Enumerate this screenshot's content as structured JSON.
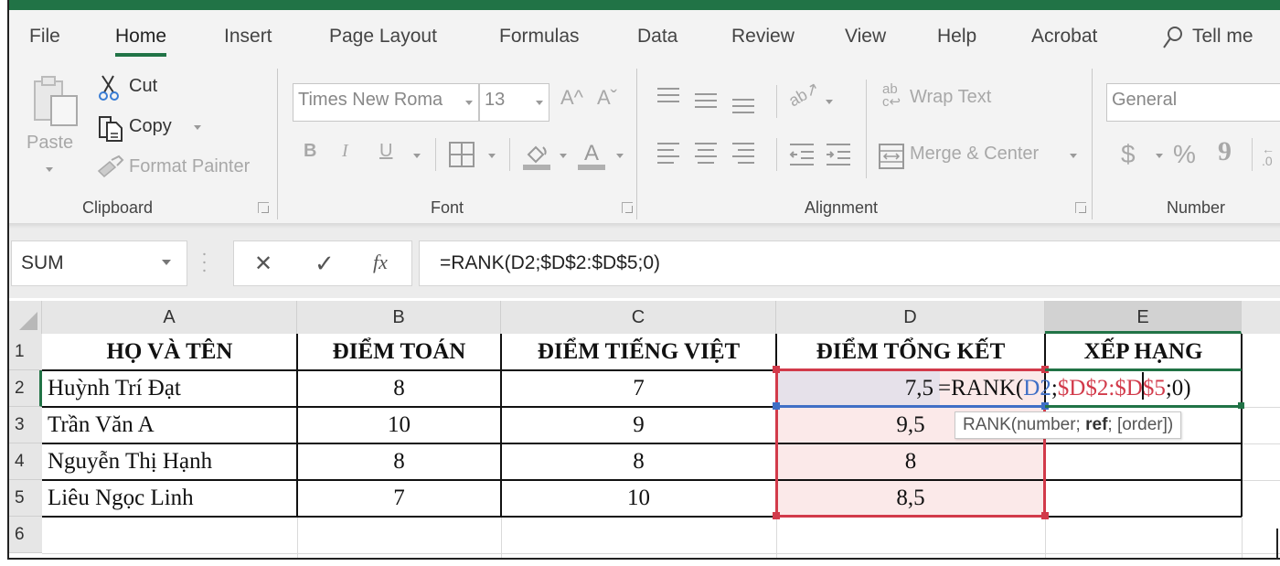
{
  "ribbon_tabs": [
    {
      "label": "File",
      "active": false
    },
    {
      "label": "Home",
      "active": true
    },
    {
      "label": "Insert",
      "active": false
    },
    {
      "label": "Page Layout",
      "active": false
    },
    {
      "label": "Formulas",
      "active": false
    },
    {
      "label": "Data",
      "active": false
    },
    {
      "label": "Review",
      "active": false
    },
    {
      "label": "View",
      "active": false
    },
    {
      "label": "Help",
      "active": false
    },
    {
      "label": "Acrobat",
      "active": false
    }
  ],
  "tell_me": {
    "label": "Tell me",
    "icon": "search-icon"
  },
  "clipboard": {
    "paste_label": "Paste",
    "cut_label": "Cut",
    "copy_label": "Copy",
    "format_painter_label": "Format Painter",
    "group_label": "Clipboard"
  },
  "font": {
    "font_name": "Times New Roma",
    "font_size": "13",
    "increase_size_icon": "A^",
    "decrease_size_icon": "Aˇ",
    "bold_label": "B",
    "italic_label": "I",
    "underline_label": "U",
    "group_label": "Font"
  },
  "alignment": {
    "wrap_text_label": "Wrap Text",
    "merge_center_label": "Merge & Center",
    "group_label": "Alignment"
  },
  "number": {
    "format_value": "General",
    "currency_symbol": "$",
    "percent_symbol": "%",
    "comma_symbol": "9",
    "group_label": "Number"
  },
  "formula_bar": {
    "name_box": "SUM",
    "cancel_icon": "✕",
    "enter_icon": "✓",
    "fx_label": "fx",
    "formula": "=RANK(D2;$D$2:$D$5;0)"
  },
  "sheet": {
    "columns": [
      "A",
      "B",
      "C",
      "D",
      "E"
    ],
    "rows": [
      "1",
      "2",
      "3",
      "4",
      "5",
      "6"
    ],
    "headers": [
      "HỌ VÀ TÊN",
      "ĐIỂM TOÁN",
      "ĐIỂM TIẾNG VIỆT",
      "ĐIỂM TỔNG KẾT",
      "XẾP HẠNG"
    ],
    "data": [
      {
        "name": "Huỳnh Trí Đạt",
        "math": "8",
        "viet": "7",
        "total": "7,5",
        "rank": ""
      },
      {
        "name": "Trần Văn A",
        "math": "10",
        "viet": "9",
        "total": "9,5",
        "rank": ""
      },
      {
        "name": "Nguyễn Thị Hạnh",
        "math": "8",
        "viet": "8",
        "total": "8",
        "rank": ""
      },
      {
        "name": "Liêu Ngọc Linh",
        "math": "7",
        "viet": "10",
        "total": "8,5",
        "rank": ""
      }
    ],
    "active_cell": "E2",
    "in_cell_editor": {
      "prefix": "=RANK(",
      "arg1": "D2",
      "sep1": ";",
      "arg2_before_cursor": "$D$2:$D",
      "arg2_after_cursor": "$5",
      "suffix": ";0)"
    },
    "tooltip": {
      "func": "RANK(number; ",
      "bold_arg": "ref",
      "rest": "; [order])"
    }
  },
  "colors": {
    "accent": "#217346",
    "ref_blue": "#3f6fc6",
    "ref_red": "#d23a4a",
    "ref_red_fill": "#fbe9e9"
  }
}
